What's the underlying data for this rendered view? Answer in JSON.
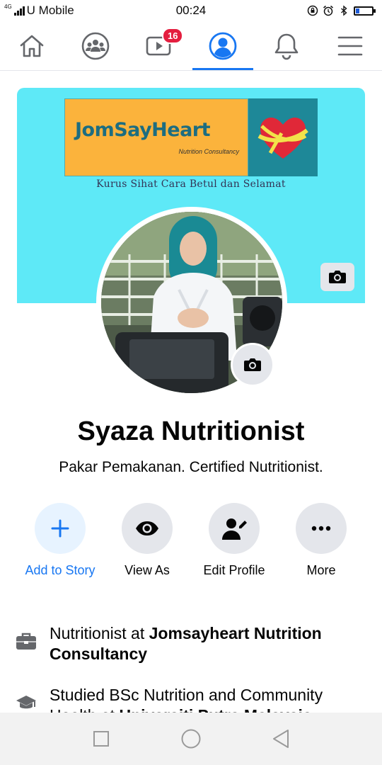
{
  "status_bar": {
    "network": "4G",
    "carrier": "U Mobile",
    "time": "00:24"
  },
  "nav": {
    "tabs": [
      {
        "name": "home",
        "icon": "home-icon"
      },
      {
        "name": "groups",
        "icon": "groups-icon"
      },
      {
        "name": "watch",
        "icon": "video-icon",
        "badge": "16"
      },
      {
        "name": "profile",
        "icon": "profile-icon",
        "active": true
      },
      {
        "name": "notifications",
        "icon": "bell-icon"
      },
      {
        "name": "menu",
        "icon": "menu-icon"
      }
    ],
    "accent": "#1877f2"
  },
  "cover": {
    "banner_title": "JomSayHeart",
    "banner_subtitle": "Nutrition Consultancy",
    "caption": "Kurus Sihat Cara Betul dan Selamat",
    "background": "#5ee9f7"
  },
  "profile": {
    "name": "Syaza Nutritionist",
    "bio": "Pakar Pemakanan. Certified Nutritionist."
  },
  "actions": [
    {
      "label": "Add to Story",
      "icon": "plus-icon"
    },
    {
      "label": "View As",
      "icon": "eye-icon"
    },
    {
      "label": "Edit Profile",
      "icon": "edit-profile-icon"
    },
    {
      "label": "More",
      "icon": "more-icon"
    }
  ],
  "intro": [
    {
      "icon": "briefcase-icon",
      "prefix": "Nutritionist at ",
      "bold": "Jomsayheart Nutrition Consultancy"
    },
    {
      "icon": "graduation-cap-icon",
      "prefix": "Studied BSc Nutrition and Community Health at ",
      "bold": "Universiti Putra Malaysia"
    }
  ]
}
